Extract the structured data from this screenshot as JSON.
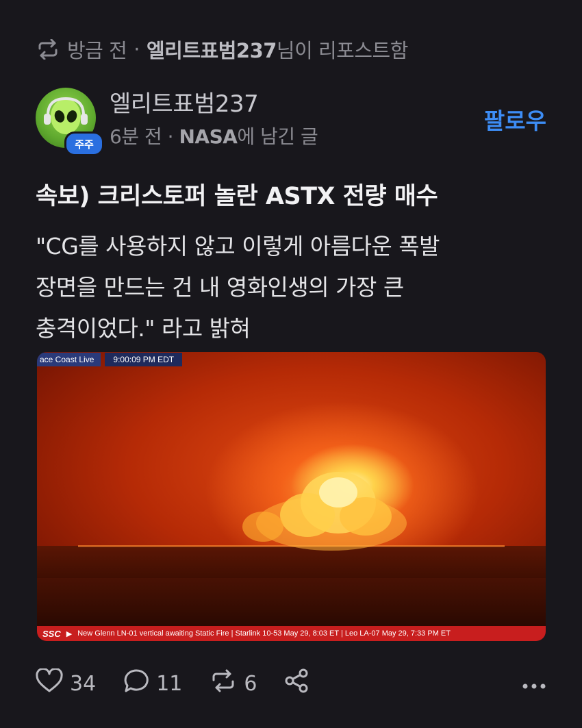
{
  "repost": {
    "time": "방금 전",
    "separator": "·",
    "user": "엘리트표범237",
    "suffix": "님이 리포스트함"
  },
  "author": {
    "name": "엘리트표범237",
    "badge": "주주",
    "time": "6분 전",
    "separator": "·",
    "board": "NASA",
    "board_suffix": "에 남긴 글",
    "follow_label": "팔로우"
  },
  "post": {
    "title": "속보) 크리스토퍼 놀란 ASTX 전량 매수",
    "body_lines": [
      "\"CG를 사용하지 않고 이렇게 아름다운 폭발",
      "장면을 만드는 건 내 영화인생의 가장 큰",
      "충격이었다.\" 라고 밝혀"
    ]
  },
  "media": {
    "live_label": "ace Coast Live",
    "time_label": "9:00:09 PM EDT",
    "ticker_logo": "SSC",
    "ticker_text": "New Glenn LN-01 vertical awaiting Static Fire | Starlink 10-53 May 29, 8:03 ET | Leo LA-07 May 29, 7:33 PM ET"
  },
  "actions": {
    "likes": "34",
    "comments": "11",
    "reposts": "6"
  },
  "colors": {
    "background": "#18171c",
    "accent": "#3d8df5",
    "badge": "#2a6fe0"
  }
}
